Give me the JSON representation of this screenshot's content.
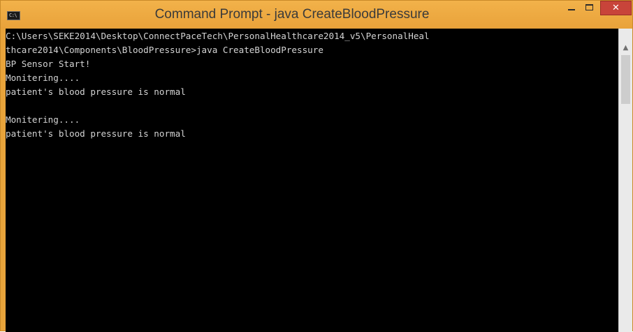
{
  "window": {
    "title": "Command Prompt - java  CreateBloodPressure",
    "icon": "cmd-icon",
    "icon_glyph": "C:\\",
    "controls": {
      "minimize": "minimize-icon",
      "maximize": "maximize-icon",
      "close": "close-icon",
      "close_glyph": "✕"
    },
    "colors": {
      "titlebar": "#e9a23a",
      "close": "#c8443a",
      "console_bg": "#000000",
      "console_text": "#d4d4d4"
    }
  },
  "console": {
    "lines": [
      "C:\\Users\\SEKE2014\\Desktop\\ConnectPaceTech\\PersonalHealthcare2014_v5\\PersonalHeal",
      "thcare2014\\Components\\BloodPressure>java CreateBloodPressure",
      "BP Sensor Start!",
      "Monitering....",
      "patient's blood pressure is normal",
      "",
      "Monitering....",
      "patient's blood pressure is normal"
    ]
  },
  "scrollbar": {
    "up_arrow": "▲"
  }
}
